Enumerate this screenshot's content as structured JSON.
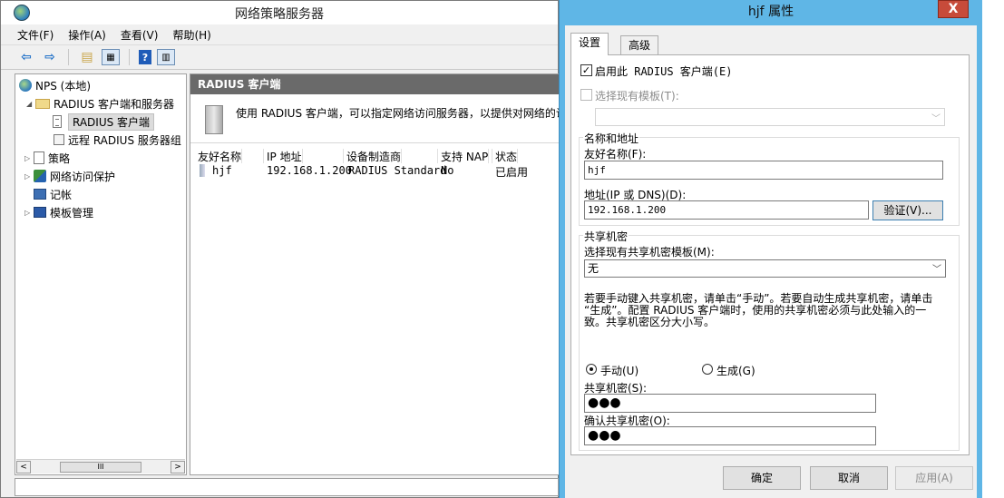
{
  "main_window": {
    "title": "网络策略服务器",
    "menu": [
      "文件(F)",
      "操作(A)",
      "查看(V)",
      "帮助(H)"
    ],
    "tree": {
      "root": "NPS (本地)",
      "radius_group": "RADIUS 客户端和服务器",
      "radius_clients": "RADIUS 客户端",
      "remote_groups": "远程 RADIUS 服务器组",
      "policies": "策略",
      "nap": "网络访问保护",
      "accounting": "记帐",
      "templates": "模板管理"
    },
    "scroll_thumb": "III",
    "content": {
      "header": "RADIUS 客户端",
      "description": "使用 RADIUS 客户端，可以指定网络访问服务器，以提供对网络的访",
      "columns": [
        "友好名称",
        "IP 地址",
        "设备制造商",
        "支持 NAP",
        "状态"
      ],
      "rows": [
        {
          "name": "hjf",
          "ip": "192.168.1.200",
          "vendor": "RADIUS Standard",
          "nap": "No",
          "status": "已启用"
        }
      ]
    }
  },
  "dialog": {
    "title": "hjf 属性",
    "close": "X",
    "tabs": [
      "设置",
      "高级"
    ],
    "enable_checkbox": "启用此 RADIUS 客户端(E)",
    "template_checkbox": "选择现有模板(T):",
    "name_group": "名称和地址",
    "friendly_name_label": "友好名称(F):",
    "friendly_name_value": "hjf",
    "address_label": "地址(IP 或 DNS)(D):",
    "address_value": "192.168.1.200",
    "verify_button": "验证(V)...",
    "secret_group": "共享机密",
    "secret_template_label": "选择现有共享机密模板(M):",
    "secret_template_value": "无",
    "explain": "若要手动键入共享机密，请单击“手动”。若要自动生成共享机密，请单击\n“生成”。配置 RADIUS 客户端时，使用的共享机密必须与此处输入的一\n致。共享机密区分大小写。",
    "manual_radio": "手动(U)",
    "generate_radio": "生成(G)",
    "secret_label": "共享机密(S):",
    "secret_value": "●●●",
    "confirm_label": "确认共享机密(O):",
    "confirm_value": "●●●",
    "ok": "确定",
    "cancel": "取消",
    "apply": "应用(A)"
  }
}
